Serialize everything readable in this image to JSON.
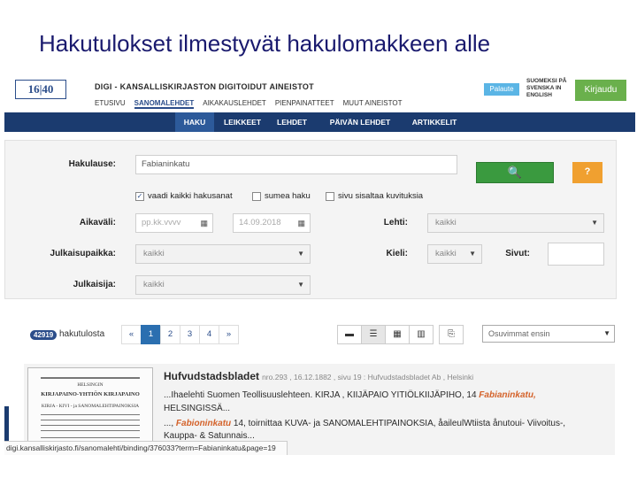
{
  "slide_title": "Hakutulokset ilmestyvät hakulomakkeen alle",
  "header": {
    "logo": "16|40",
    "site_title": "DIGI - KANSALLISKIRJASTON DIGITOIDUT AINEISTOT",
    "nav": [
      "ETUSIVU",
      "SANOMALEHDET",
      "AIKAKAUSLEHDET",
      "PIENPAINATTEET",
      "MUUT AINEISTOT"
    ],
    "feedback": "Palaute",
    "lang": "SUOMEKSI PÅ SVENSKA IN ENGLISH",
    "login": "Kirjaudu"
  },
  "subnav": [
    "HAKU",
    "LEIKKEET",
    "LEHDET",
    "PÄIVÄN LEHDET",
    "ARTIKKELIT"
  ],
  "form": {
    "query_label": "Hakulause:",
    "query_value": "Fabianinkatu",
    "checkbox_all_words": "vaadi kaikki hakusanat",
    "checkbox_fuzzy": "sumea haku",
    "checkbox_images": "sivu sisaltaa kuvituksia",
    "daterange_label": "Aikaväli:",
    "date_from_placeholder": "pp.kk.vvvv",
    "date_to_value": "14.09.2018",
    "paper_label": "Lehti:",
    "paper_value": "kaikki",
    "place_label": "Julkaisupaikka:",
    "place_value": "kaikki",
    "language_label": "Kieli:",
    "language_value": "kaikki",
    "pages_label": "Sivut:",
    "publisher_label": "Julkaisija:",
    "publisher_value": "kaikki"
  },
  "results": {
    "count": "42919",
    "count_label": "hakutulosta",
    "pages": [
      "«",
      "1",
      "2",
      "3",
      "4",
      "»"
    ],
    "sort_value": "Osuvimmat ensin"
  },
  "result_item": {
    "paper": "Hufvudstadsbladet",
    "meta": "nro.293 , 16.12.1882 , sivu 19 : Hufvudstadsbladet Ab , Helsinki",
    "line1_pre": "...Ihaelehti Suomen Teollisuuslehteen. KIRJA , KIIJÄPAIO YITIÖLKIIJÄPIHO, 14 ",
    "line1_hl": "Fabianinkatu,",
    "line2": "HELSINGISSÄ...",
    "line3_pre": "..., ",
    "line3_hl": "Fabioninkatu",
    "line3_post": " 14, toirnittaa KUVA- ja SANOMALEHTIPAINOKSIA, åaileulWtiista ånutoui- Viivoitus-,",
    "line4": "Kauppa- & Satunnais...",
    "thumb_lines": [
      "HELSINGIN",
      "KIRJAPAINO-YHTIÖN KIRJAPAINO",
      "KIRJA - KIVI - ja SANOMALEHTIPAINOKSIA"
    ]
  },
  "status_url": "digi.kansalliskirjasto.fi/sanomalehti/binding/376033?term=Fabianinkatu&page=19"
}
